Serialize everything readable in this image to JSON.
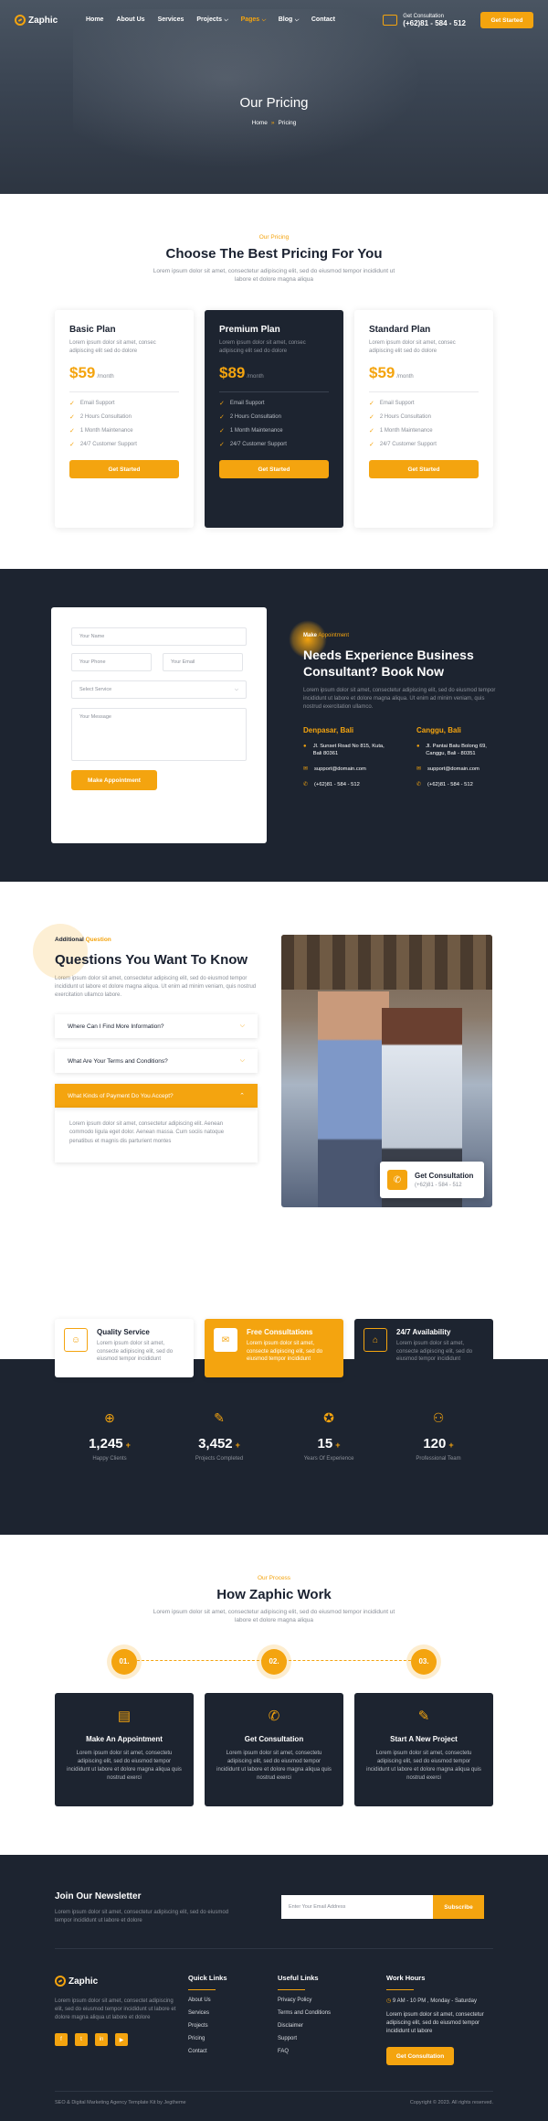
{
  "nav": {
    "brand": "Zaphic",
    "items": [
      {
        "label": "Home",
        "chev": ""
      },
      {
        "label": "About Us",
        "chev": ""
      },
      {
        "label": "Services",
        "chev": ""
      },
      {
        "label": "Projects",
        "chev": "⌵"
      },
      {
        "label": "Pages",
        "chev": "⌵"
      },
      {
        "label": "Blog",
        "chev": "⌵"
      },
      {
        "label": "Contact",
        "chev": ""
      }
    ],
    "active_item": "Pages",
    "consult_label": "Get Consultation",
    "consult_phone": "(+62)81 - 584 - 512",
    "cta": "Get Started"
  },
  "hero": {
    "title": "Our Pricing",
    "crumb_home": "Home",
    "crumb_sep": "»",
    "crumb_current": "Pricing"
  },
  "pricing": {
    "tag": "Our Pricing",
    "title": "Choose The Best Pricing For You",
    "desc": "Lorem ipsum dolor sit amet, consectetur adipiscing elit, sed do eiusmod tempor incididunt ut labore et dolore magna aliqua",
    "plans": [
      {
        "name": "Basic Plan",
        "desc": "Lorem ipsum dolor sit amet, consec adipiscing elit sed do dolore",
        "price": "$59",
        "per": "/month",
        "features": [
          "Email Support",
          "2 Hours Consultation",
          "1 Month Maintenance",
          "24/7 Customer Support"
        ],
        "button": "Get Started"
      },
      {
        "name": "Premium Plan",
        "desc": "Lorem ipsum dolor sit amet, consec adipiscing elit sed do dolore",
        "price": "$89",
        "per": "/month",
        "features": [
          "Email Support",
          "2 Hours Consultation",
          "1 Month Maintenance",
          "24/7 Customer Support"
        ],
        "button": "Get Started"
      },
      {
        "name": "Standard Plan",
        "desc": "Lorem ipsum dolor sit amet, consec adipiscing elit sed do dolore",
        "price": "$59",
        "per": "/month",
        "features": [
          "Email Support",
          "2 Hours Consultation",
          "1 Month Maintenance",
          "24/7 Customer Support"
        ],
        "button": "Get Started"
      }
    ]
  },
  "appointment": {
    "form": {
      "name_ph": "Your Name",
      "phone_ph": "Your Phone",
      "email_ph": "Your Email",
      "service_ph": "Select Service",
      "message_ph": "Your Message",
      "submit": "Make Appointment"
    },
    "tag_a": "Make",
    "tag_b": "Appointment",
    "title": "Needs Experience Business Consultant? Book Now",
    "desc": "Lorem ipsum dolor sit amet, consectetur adipiscing elit, sed do eiusmod tempor incididunt ut labore et dolore magna aliqua. Ut enim ad minim veniam, quis nostrud exercitation ullamco.",
    "offices": [
      {
        "city": "Denpasar, Bali",
        "address": "Jl. Sunset Road No 815, Kuta, Bali 80361",
        "email": "support@domain.com",
        "phone": "(+62)81 - 584 - 512"
      },
      {
        "city": "Canggu, Bali",
        "address": "Jl. Pantai Batu Bolong 69, Canggu, Bali - 80351",
        "email": "support@domain.com",
        "phone": "(+62)81 - 584 - 512"
      }
    ]
  },
  "faq": {
    "tag_a": "Additional",
    "tag_b": "Question",
    "title": "Questions You Want To Know",
    "desc": "Lorem ipsum dolor sit amet, consectetur adipiscing elit, sed do eiusmod tempor incididunt ut labore et dolore magna aliqua. Ut enim ad minim veniam, quis nostrud exercitation ullamco labore.",
    "items": [
      {
        "q": "Where Can I Find More Information?",
        "arrow": "⌵"
      },
      {
        "q": "What Are Your Terms and Conditions?",
        "arrow": "⌵"
      },
      {
        "q": "What Kinds of Payment Do You Accept?",
        "arrow": "⌃"
      }
    ],
    "answer": "Lorem ipsum dolor sit amet, consectetur adipiscing elit. Aenean commodo ligula eget dolor. Aenean massa. Cum sociis natoque penatibus et magnis dis parturient montes",
    "consult_title": "Get Consultation",
    "consult_phone": "(+62)81 - 584 - 512"
  },
  "features": [
    {
      "title": "Quality Service",
      "desc": "Lorem ipsum dolor sit amet, consecte adipiscing elit, sed do eiusmod tempor incididunt",
      "icon": "☺"
    },
    {
      "title": "Free Consultations",
      "desc": "Lorem ipsum dolor sit amet, consecte adipiscing elit, sed do eiusmod tempor incididunt",
      "icon": "✉"
    },
    {
      "title": "24/7 Availability",
      "desc": "Lorem ipsum dolor sit amet, consecte adipiscing elit, sed do eiusmod tempor incididunt",
      "icon": "⌂"
    }
  ],
  "counters": [
    {
      "value": "1,245",
      "plus": "+",
      "label": "Happy Clients",
      "icon": "⊕"
    },
    {
      "value": "3,452",
      "plus": "+",
      "label": "Projects Completed",
      "icon": "✎"
    },
    {
      "value": "15",
      "plus": "+",
      "label": "Years Of Experience",
      "icon": "✪"
    },
    {
      "value": "120",
      "plus": "+",
      "label": "Professional Team",
      "icon": "⚇"
    }
  ],
  "process": {
    "tag": "Our Process",
    "title": "How Zaphic Work",
    "desc": "Lorem ipsum dolor sit amet, consectetur adipiscing elit, sed do eiusmod tempor incididunt ut labore et dolore magna aliqua",
    "steps": [
      {
        "num": "01.",
        "title": "Make An Appointment",
        "desc": "Lorem ipsum dolor sit amet, consectetu adipiscing elit, sed do eiusmod tempor incididunt ut labore et dolore magna aliqua quis nostrud exerci",
        "icon": "▤"
      },
      {
        "num": "02.",
        "title": "Get Consultation",
        "desc": "Lorem ipsum dolor sit amet, consectetu adipiscing elit, sed do eiusmod tempor incididunt ut labore et dolore magna aliqua quis nostrud exerci",
        "icon": "✆"
      },
      {
        "num": "03.",
        "title": "Start A New Project",
        "desc": "Lorem ipsum dolor sit amet, consectetu adipiscing elit, sed do eiusmod tempor incididunt ut labore et dolore magna aliqua quis nostrud exerci",
        "icon": "✎"
      }
    ]
  },
  "footer": {
    "newsletter_title": "Join Our Newsletter",
    "newsletter_desc": "Lorem ipsum dolor sit amet, consectetur adipiscing elit, sed do eiusmod tempor incididunt ut labore et dolore",
    "email_ph": "Enter Your Email Address",
    "subscribe": "Subscribe",
    "brand": "Zaphic",
    "about": "Lorem ipsum dolor sit amet, consectet adipiscing elit, sed do eiusmod tempor incididunt ut labore et dolore magna aliqua ut labore et dolore",
    "socials": [
      "f",
      "t",
      "in",
      "▶"
    ],
    "quick_title": "Quick Links",
    "quick_links": [
      "About Us",
      "Services",
      "Projects",
      "Pricing",
      "Contact"
    ],
    "useful_title": "Useful Links",
    "useful_links": [
      "Privacy Policy",
      "Terms and Conditions",
      "Disclaimer",
      "Support",
      "FAQ"
    ],
    "hours_title": "Work Hours",
    "hours": "9 AM - 10 PM , Monday - Saturday",
    "hours_desc": "Lorem ipsum dolor sit amet, consectetur adipiscing elit, sed do eiusmod tempor incididunt ut labore",
    "hours_btn": "Get Consultation",
    "copyright_left": "SEO & Digital Marketing Agency Template Kit by Jegtheme",
    "copyright_right": "Copyright © 2023. All rights reserved."
  },
  "colors": {
    "accent": "#f4a40f",
    "dark": "#1d2430"
  }
}
